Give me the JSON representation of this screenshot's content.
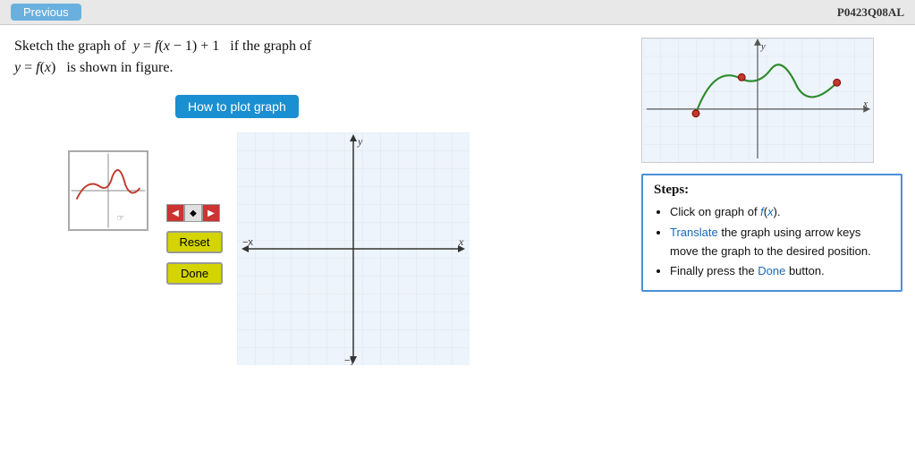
{
  "topbar": {
    "prev_label": "Previous",
    "problem_id": "P0423Q08AL"
  },
  "problem": {
    "line1": "Sketch the graph of  y = f(x − 1) + 1  if the graph of",
    "line2": "y = f(x)  is shown in figure."
  },
  "how_to_btn": "How to plot graph",
  "controls": {
    "reset_label": "Reset",
    "done_label": "Done"
  },
  "graph": {
    "x_label": "x",
    "y_label": "y",
    "neg_x_label": "−x",
    "neg_y_label": "−y"
  },
  "steps": {
    "title": "Steps:",
    "items": [
      "Click on graph of f(x).",
      "Translate the graph using arrow keys move the graph to the desired position.",
      "Finally press the Done button."
    ]
  }
}
